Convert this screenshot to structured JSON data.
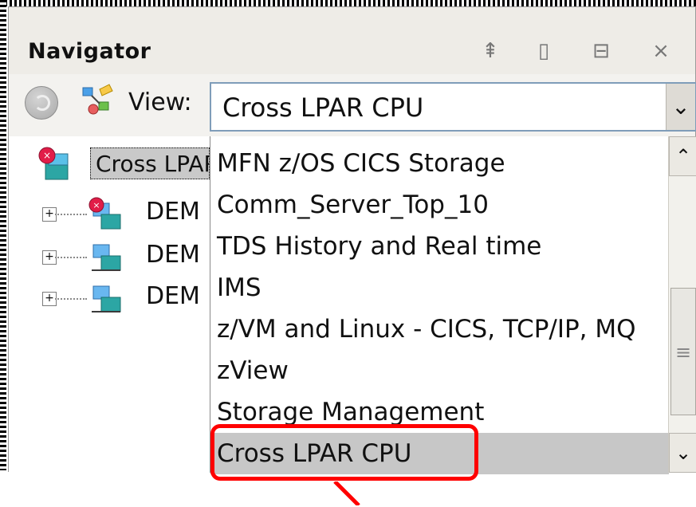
{
  "panel": {
    "title": "Navigator",
    "controls": [
      "maximize-icon",
      "split-vertical-icon",
      "split-horizontal-icon",
      "close-icon"
    ]
  },
  "toolbar": {
    "back_icon": "back-icon",
    "view_icon": "view-icon",
    "view_label": "View:",
    "selected_view": "Cross LPAR CPU"
  },
  "tree": {
    "root_label": "Cross LPAR CPU",
    "nodes": [
      {
        "label": "DEM"
      },
      {
        "label": "DEM"
      },
      {
        "label": "DEM"
      }
    ]
  },
  "dropdown": {
    "items": [
      "MFN z/OS CICS Storage",
      "Comm_Server_Top_10",
      "TDS History and Real time",
      "IMS",
      "z/VM and Linux - CICS, TCP/IP, MQ",
      "zView",
      "Storage Management",
      "Cross LPAR CPU"
    ],
    "selected_item": "Cross LPAR CPU"
  },
  "colors": {
    "selection": "#c7c7c7",
    "highlight": "#ff0000",
    "combo_border": "#7f9db9"
  }
}
